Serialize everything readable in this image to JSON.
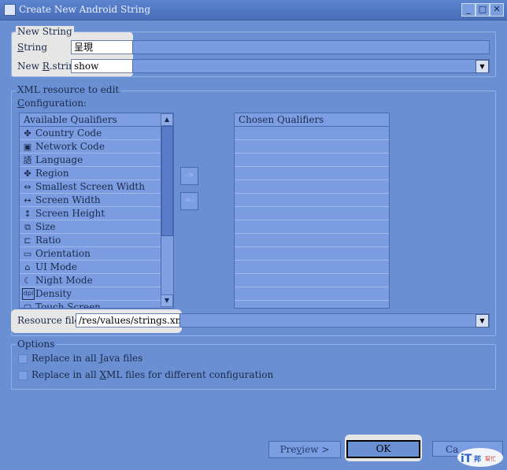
{
  "window": {
    "title": "Create New Android String"
  },
  "new_string": {
    "group_label": "New String",
    "string_label_pre": "",
    "string_label_u": "S",
    "string_label_post": "tring",
    "string_value": "呈現",
    "rstring_label_pre": "New ",
    "rstring_label_u": "R",
    "rstring_label_post": ".string:",
    "rstring_value": "show"
  },
  "xml_resource": {
    "group_label": "XML resource to edit",
    "config_pre": "",
    "config_u": "C",
    "config_post": "onfiguration:",
    "available_header": "Available Qualifiers",
    "available": [
      {
        "label": "Country Code",
        "icon": "country-code-icon",
        "glyph": "✤"
      },
      {
        "label": "Network Code",
        "icon": "network-code-icon",
        "glyph": "▣"
      },
      {
        "label": "Language",
        "icon": "language-icon",
        "glyph": "語"
      },
      {
        "label": "Region",
        "icon": "region-icon",
        "glyph": "✤"
      },
      {
        "label": "Smallest Screen Width",
        "icon": "smallest-width-icon",
        "glyph": "⇔"
      },
      {
        "label": "Screen Width",
        "icon": "screen-width-icon",
        "glyph": "↔"
      },
      {
        "label": "Screen Height",
        "icon": "screen-height-icon",
        "glyph": "↕"
      },
      {
        "label": "Size",
        "icon": "size-icon",
        "glyph": "⧉"
      },
      {
        "label": "Ratio",
        "icon": "ratio-icon",
        "glyph": "⊏"
      },
      {
        "label": "Orientation",
        "icon": "orientation-icon",
        "glyph": "▭"
      },
      {
        "label": "UI Mode",
        "icon": "ui-mode-icon",
        "glyph": "⌂"
      },
      {
        "label": "Night Mode",
        "icon": "night-mode-icon",
        "glyph": "☾"
      },
      {
        "label": "Density",
        "icon": "density-icon",
        "glyph": "dpi"
      },
      {
        "label": "Touch Screen",
        "icon": "touch-screen-icon",
        "glyph": "▢"
      }
    ],
    "add_glyph": "->",
    "remove_glyph": "<-",
    "chosen_header": "Chosen Qualifiers",
    "resource_file_label": "Resource file:",
    "resource_file_value": "/res/values/strings.xml"
  },
  "options": {
    "group_label": "Options",
    "opt1_pre": "Replace in all ",
    "opt1_u": "J",
    "opt1_post": "ava files",
    "opt2_pre": "Replace in all ",
    "opt2_u": "X",
    "opt2_post": "ML files for different configuration"
  },
  "buttons": {
    "preview_pre": "Pre",
    "preview_u": "v",
    "preview_post": "iew >",
    "ok": "OK",
    "cancel_visible": "Ca"
  },
  "colors": {
    "background": "#6b8fd3",
    "highlight": "#e6e6e6"
  }
}
